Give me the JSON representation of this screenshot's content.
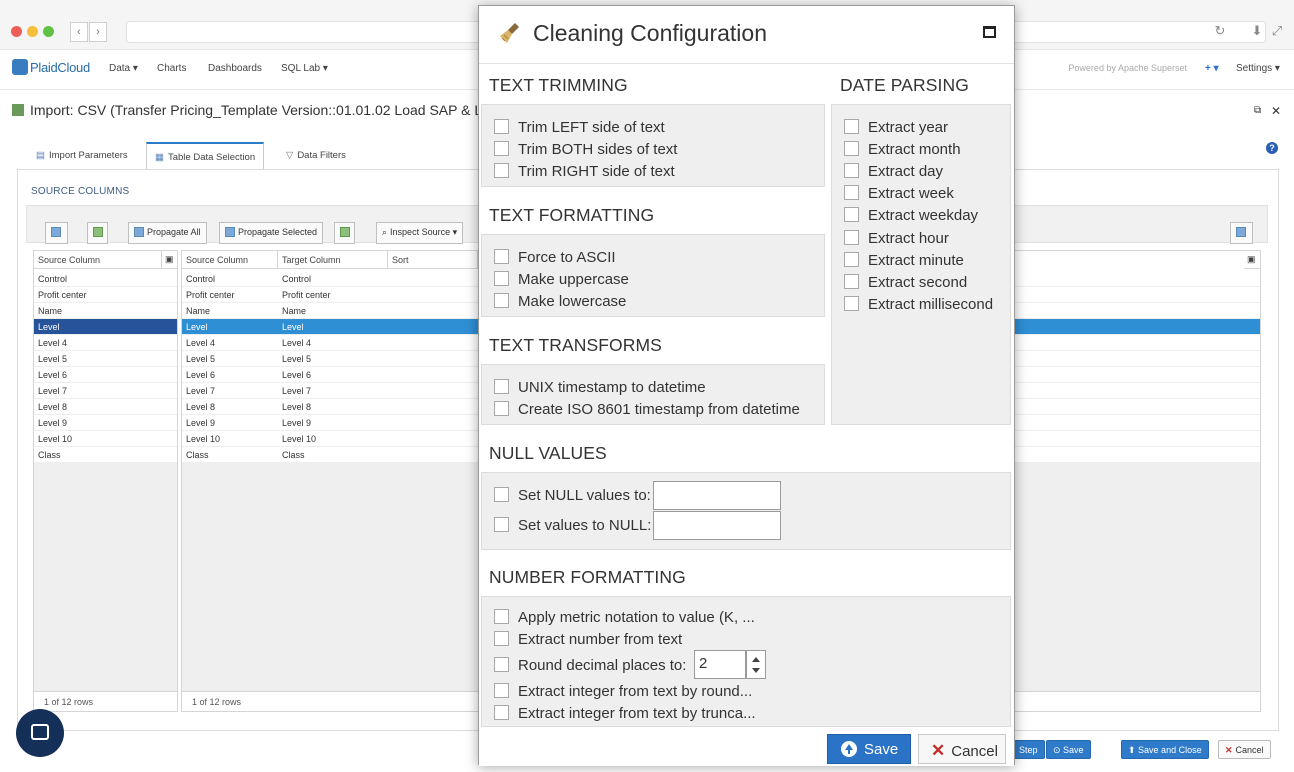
{
  "app": {
    "logo": "PlaidCloud",
    "nav": [
      "Data ▾",
      "Charts",
      "Dashboards",
      "SQL Lab ▾"
    ],
    "powered_by": "Powered by Apache Superset",
    "plus_menu": "+ ▾",
    "settings": "Settings ▾"
  },
  "page": {
    "title": "Import: CSV (Transfer Pricing_Template Version::01.01.02 Load SAP & LE",
    "tabs": [
      "Import Parameters",
      "Table Data Selection",
      "Data Filters"
    ],
    "active_tab": "Table Data Selection",
    "source_columns_label": "SOURCE COLUMNS",
    "toolbar": {
      "propagate_all": "Propagate All",
      "propagate_selected": "Propagate Selected",
      "inspect_source": "Inspect Source ▾"
    }
  },
  "grid_left": {
    "header": "Source Column",
    "rows": [
      "Control",
      "Profit center",
      "Name",
      "Level",
      "Level 4",
      "Level 5",
      "Level 6",
      "Level 7",
      "Level 8",
      "Level 9",
      "Level 10",
      "Class"
    ],
    "selected_row": "Level",
    "footer": "1 of 12 rows"
  },
  "grid_right": {
    "headers": [
      "Source Column",
      "Target Column",
      "Sort"
    ],
    "rows": [
      [
        "Control",
        "Control"
      ],
      [
        "Profit center",
        "Profit center"
      ],
      [
        "Name",
        "Name"
      ],
      [
        "Level",
        "Level"
      ],
      [
        "Level 4",
        "Level 4"
      ],
      [
        "Level 5",
        "Level 5"
      ],
      [
        "Level 6",
        "Level 6"
      ],
      [
        "Level 7",
        "Level 7"
      ],
      [
        "Level 8",
        "Level 8"
      ],
      [
        "Level 9",
        "Level 9"
      ],
      [
        "Level 10",
        "Level 10"
      ],
      [
        "Class",
        "Class"
      ]
    ],
    "footer": "1 of 12 rows"
  },
  "bottom_bar": {
    "step": "Step",
    "save": "Save",
    "save_close": "Save and Close",
    "cancel": "Cancel"
  },
  "modal": {
    "title": "Cleaning Configuration",
    "sections": {
      "text_trimming": {
        "title": "TEXT TRIMMING",
        "options": [
          "Trim LEFT side of text",
          "Trim BOTH sides of text",
          "Trim RIGHT side of text"
        ]
      },
      "text_formatting": {
        "title": "TEXT FORMATTING",
        "options": [
          "Force to ASCII",
          "Make uppercase",
          "Make lowercase"
        ]
      },
      "text_transforms": {
        "title": "TEXT TRANSFORMS",
        "options": [
          "UNIX timestamp to datetime",
          "Create ISO 8601 timestamp from datetime"
        ]
      },
      "date_parsing": {
        "title": "DATE PARSING",
        "options": [
          "Extract year",
          "Extract month",
          "Extract day",
          "Extract week",
          "Extract weekday",
          "Extract hour",
          "Extract minute",
          "Extract second",
          "Extract millisecond"
        ]
      },
      "null_values": {
        "title": "NULL VALUES",
        "options": [
          "Set NULL values to:",
          "Set values to NULL:"
        ],
        "input_values": [
          "",
          ""
        ]
      },
      "number_formatting": {
        "title": "NUMBER FORMATTING",
        "options": [
          "Apply metric notation to value (K, ...",
          "Extract number from text",
          "Round decimal places to:",
          "Extract integer from text by round...",
          "Extract integer from text by trunca..."
        ],
        "round_value": "2"
      }
    },
    "save_label": "Save",
    "cancel_label": "Cancel"
  },
  "colors": {
    "accent": "#2a73c6",
    "selected_row": "#2f8fd4",
    "section_bg": "#efefef"
  }
}
